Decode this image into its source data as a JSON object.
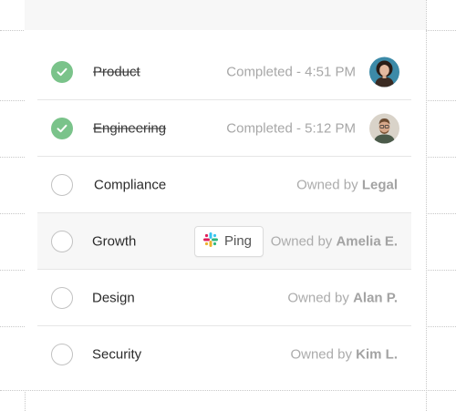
{
  "colors": {
    "done_check": "#7ac38a",
    "muted_text": "#a7a7a7",
    "row_highlight": "#f7f7f7"
  },
  "tasks": [
    {
      "label": "Product",
      "state": "done",
      "status": "Completed - 4:51 PM",
      "avatar": "woman-avatar"
    },
    {
      "label": "Engineering",
      "state": "done",
      "status": "Completed - 5:12 PM",
      "avatar": "man-avatar"
    },
    {
      "label": "Compliance",
      "state": "todo",
      "owned_prefix": "Owned by",
      "owner": "Legal"
    },
    {
      "label": "Growth",
      "state": "todo",
      "owned_prefix": "Owned by",
      "owner": "Amelia E.",
      "action": {
        "label": "Ping",
        "icon": "slack-icon"
      }
    },
    {
      "label": "Design",
      "state": "todo",
      "owned_prefix": "Owned by",
      "owner": "Alan P."
    },
    {
      "label": "Security",
      "state": "todo",
      "owned_prefix": "Owned by",
      "owner": "Kim L."
    }
  ]
}
